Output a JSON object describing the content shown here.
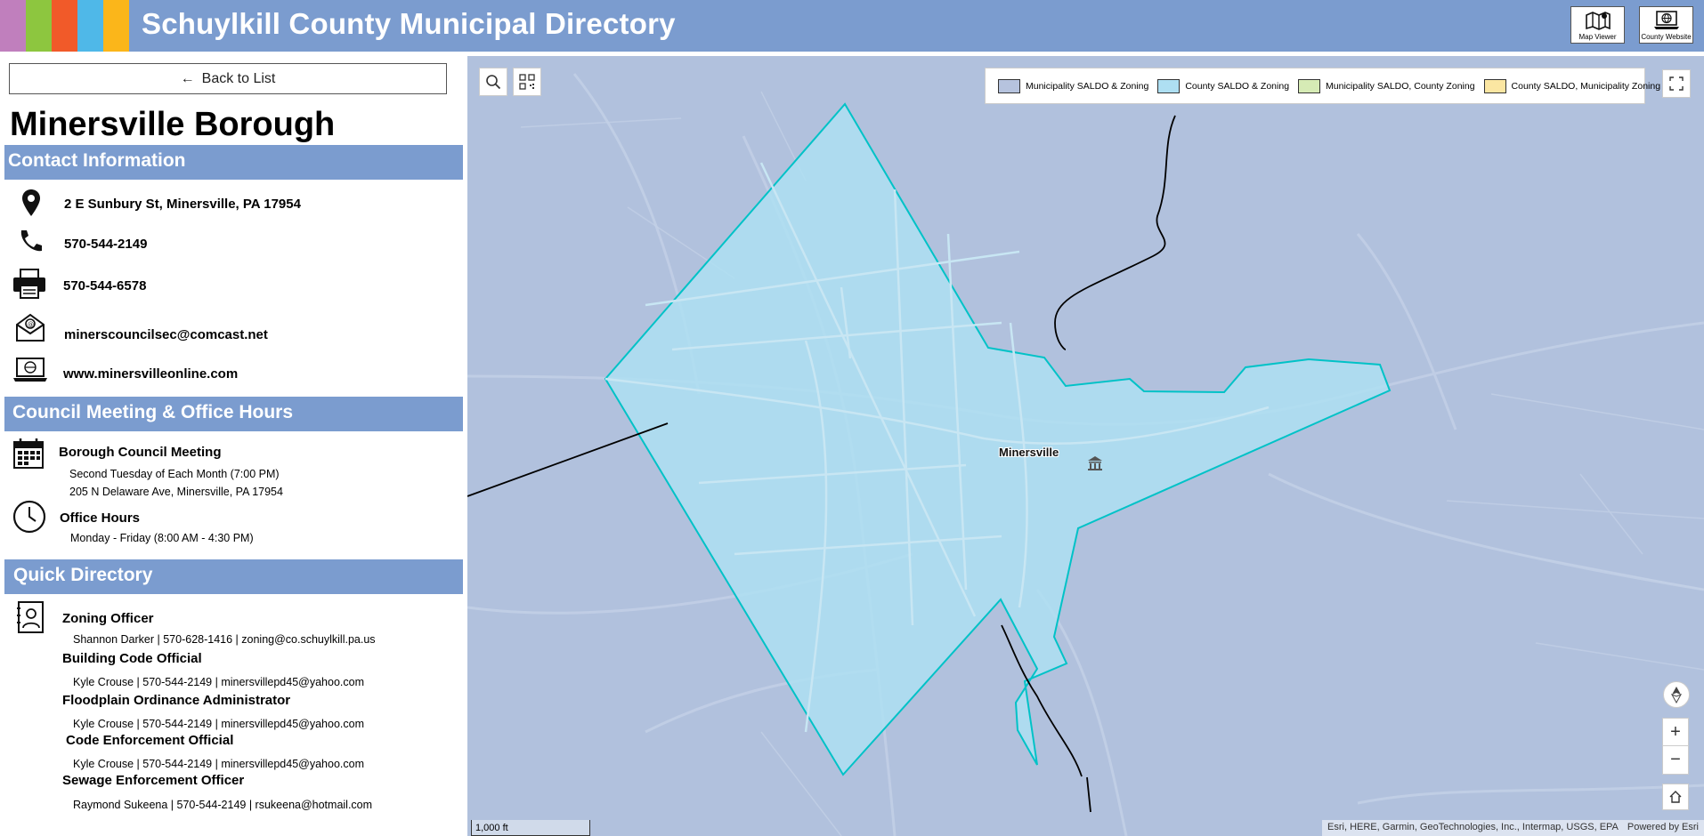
{
  "header": {
    "title": "Schuylkill County Municipal Directory",
    "stripe_colors": [
      "#c07fbd",
      "#8dc63f",
      "#f15a29",
      "#4fb8e8",
      "#fbb61a"
    ],
    "map_viewer_label": "Map Viewer",
    "county_website_label": "County Website",
    "bar_color": "#7b9ccf"
  },
  "left": {
    "back_label": "Back to List",
    "municipality": "Minersville Borough",
    "contact_heading": "Contact Information",
    "contact": {
      "address": "2 E Sunbury St, Minersville, PA 17954",
      "phone": "570-544-2149",
      "fax": "570-544-6578",
      "email": "minerscouncilsec@comcast.net",
      "website": "www.minersvilleonline.com"
    },
    "meeting_heading": "Council Meeting & Office Hours",
    "meeting": {
      "title": "Borough Council Meeting",
      "schedule": "Second Tuesday of Each Month (7:00 PM)",
      "location": "205 N Delaware Ave, Minersville, PA 17954",
      "office_title": "Office Hours",
      "office_hours": "Monday - Friday (8:00 AM - 4:30 PM)"
    },
    "directory_heading": "Quick Directory",
    "directory": [
      {
        "role": "Zoning Officer",
        "details": "Shannon Darker | 570-628-1416 | zoning@co.schuylkill.pa.us"
      },
      {
        "role": "Building Code Official",
        "details": "Kyle Crouse | 570-544-2149 | minersvillepd45@yahoo.com"
      },
      {
        "role": "Floodplain Ordinance Administrator",
        "details": "Kyle Crouse | 570-544-2149 | minersvillepd45@yahoo.com"
      },
      {
        "role": "Code Enforcement Official",
        "details": "Kyle Crouse | 570-544-2149 | minersvillepd45@yahoo.com"
      },
      {
        "role": "Sewage Enforcement Officer",
        "details": "Raymond Sukeena | 570-544-2149 | rsukeena@hotmail.com"
      }
    ]
  },
  "map": {
    "legend": [
      {
        "label": "Municipality SALDO & Zoning",
        "color": "#b6c3de"
      },
      {
        "label": "County SALDO & Zoning",
        "color": "#aedff2"
      },
      {
        "label": "Municipality SALDO, County Zoning",
        "color": "#d6ebb5"
      },
      {
        "label": "County SALDO, Municipality Zoning",
        "color": "#fbe6a2"
      }
    ],
    "place_label": "Minersville",
    "scale_label": "1,000 ft",
    "attribution": "Esri, HERE, Garmin, GeoTechnologies, Inc., Intermap, USGS, EPA",
    "powered_by": "Powered by Esri",
    "zoom_in": "+",
    "zoom_out": "−",
    "boundary_fill": "#aedff2",
    "boundary_stroke": "#00c2c7"
  }
}
